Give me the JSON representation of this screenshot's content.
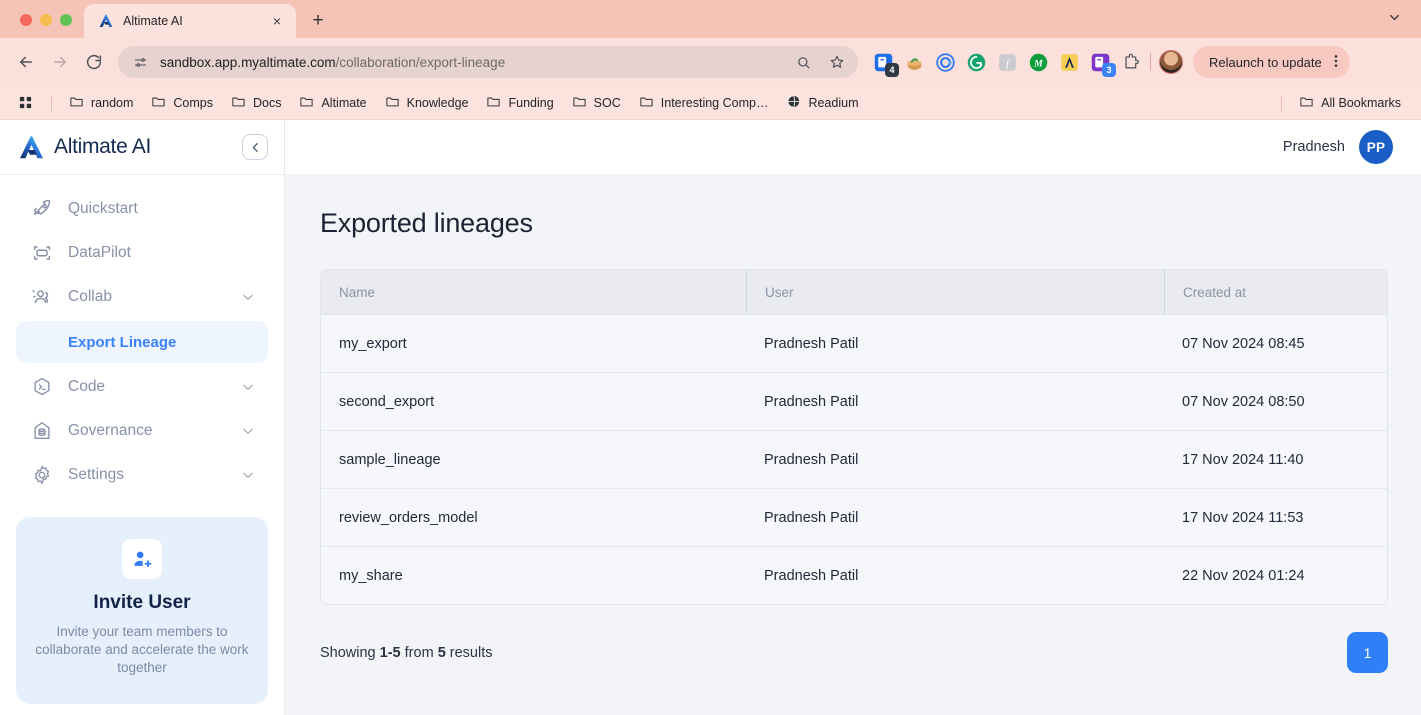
{
  "browser": {
    "tab": {
      "title": "Altimate AI",
      "favicon": "altimate-logo-icon",
      "close": "×"
    },
    "new_tab": "+",
    "tabstrip_menu": "chevron-down-icon",
    "nav": {
      "back": "back-arrow-icon",
      "forward": "forward-arrow-icon",
      "reload": "reload-icon"
    },
    "omnibox": {
      "site_settings_icon": "site-settings-icon",
      "url_host": "sandbox.app.myaltimate.com",
      "url_path": "/collaboration/export-lineage",
      "search_icon": "search-icon",
      "bookmark_icon": "star-icon"
    },
    "extensions": [
      {
        "name": "bitwarden-extension-icon",
        "badge": "4"
      },
      {
        "name": "honey-extension-icon",
        "badge": ""
      },
      {
        "name": "coda-extension-icon",
        "badge": ""
      },
      {
        "name": "grammarly-extension-icon",
        "badge": ""
      },
      {
        "name": "fontanello-extension-icon",
        "badge": ""
      },
      {
        "name": "metamask-extension-icon",
        "badge": ""
      },
      {
        "name": "altimate-extension-icon",
        "badge": ""
      },
      {
        "name": "bitwarden-secondary-extension-icon",
        "badge": "3"
      },
      {
        "name": "extensions-puzzle-icon",
        "badge": ""
      }
    ],
    "profile": "profile-avatar",
    "relaunch_label": "Relaunch to update",
    "menu_icon": "kebab-menu-icon",
    "bookmarks": {
      "apps_icon": "apps-grid-icon",
      "items": [
        {
          "label": "random",
          "icon": "folder-icon"
        },
        {
          "label": "Comps",
          "icon": "folder-icon"
        },
        {
          "label": "Docs",
          "icon": "folder-icon"
        },
        {
          "label": "Altimate",
          "icon": "folder-icon"
        },
        {
          "label": "Knowledge",
          "icon": "folder-icon"
        },
        {
          "label": "Funding",
          "icon": "folder-icon"
        },
        {
          "label": "SOC",
          "icon": "folder-icon"
        },
        {
          "label": "Interesting Comp…",
          "icon": "folder-icon"
        },
        {
          "label": "Readium",
          "icon": "globe-icon"
        }
      ],
      "all_bookmarks": {
        "label": "All Bookmarks",
        "icon": "folder-icon"
      }
    }
  },
  "sidebar": {
    "brand": "Altimate AI",
    "brand_logo": "altimate-logo-icon",
    "collapse_icon": "chevron-left-icon",
    "items": [
      {
        "label": "Quickstart",
        "icon": "rocket-icon",
        "expandable": false
      },
      {
        "label": "DataPilot",
        "icon": "datapilot-icon",
        "expandable": false
      },
      {
        "label": "Collab",
        "icon": "users-icon",
        "expandable": true
      },
      {
        "label": "Code",
        "icon": "terminal-icon",
        "expandable": true
      },
      {
        "label": "Governance",
        "icon": "governance-icon",
        "expandable": true
      },
      {
        "label": "Settings",
        "icon": "gear-icon",
        "expandable": true
      }
    ],
    "active_sub_item": "Export Lineage",
    "invite": {
      "icon": "add-user-icon",
      "title": "Invite User",
      "description": "Invite your team members to collaborate and accelerate the work together"
    }
  },
  "topbar": {
    "user_name": "Pradnesh",
    "avatar_initials": "PP"
  },
  "main": {
    "page_title": "Exported lineages",
    "table": {
      "columns": [
        "Name",
        "User",
        "Created at"
      ],
      "rows": [
        {
          "name": "my_export",
          "user": "Pradnesh Patil",
          "created_at": "07 Nov 2024 08:45"
        },
        {
          "name": "second_export",
          "user": "Pradnesh Patil",
          "created_at": "07 Nov 2024 08:50"
        },
        {
          "name": "sample_lineage",
          "user": "Pradnesh Patil",
          "created_at": "17 Nov 2024 11:40"
        },
        {
          "name": "review_orders_model",
          "user": "Pradnesh Patil",
          "created_at": "17 Nov 2024 11:53"
        },
        {
          "name": "my_share",
          "user": "Pradnesh Patil",
          "created_at": "22 Nov 2024 01:24"
        }
      ]
    },
    "footer": {
      "showing_prefix": "Showing ",
      "showing_range": "1-5",
      "showing_middle": " from ",
      "showing_total": "5",
      "showing_suffix": " results",
      "current_page": "1"
    }
  },
  "colors": {
    "accent_blue": "#2F80F7",
    "active_nav_blue": "#3B82F6",
    "avatar_blue": "#1B5FC6",
    "chrome_pink": "#FBE0DB",
    "content_bg": "#F2F4F7"
  }
}
